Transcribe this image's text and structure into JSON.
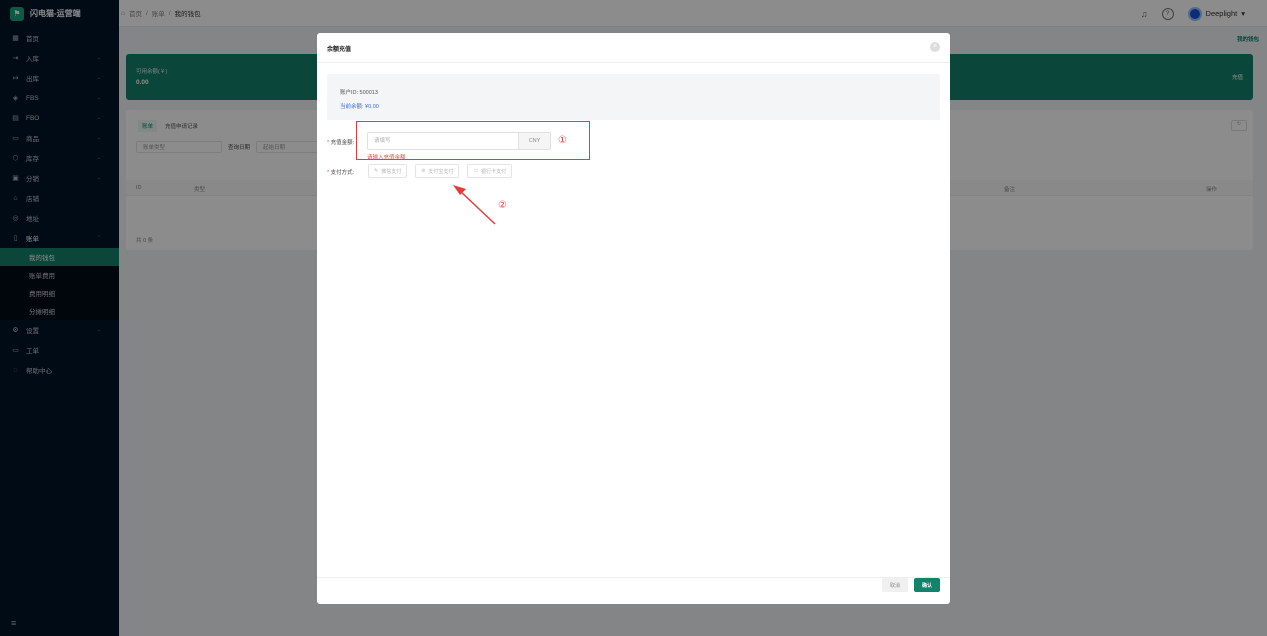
{
  "app": {
    "name": "闪电猫-运营端"
  },
  "breadcrumb": [
    "首页",
    "账单",
    "我的钱包"
  ],
  "header": {
    "username": "Deeplight"
  },
  "sidebar": {
    "items": [
      {
        "label": "首页",
        "icon": "home-icon"
      },
      {
        "label": "入库",
        "icon": "inbound-icon"
      },
      {
        "label": "出库",
        "icon": "outbound-icon"
      },
      {
        "label": "FBS",
        "icon": "cube-icon"
      },
      {
        "label": "FBO",
        "icon": "warehouse-icon"
      },
      {
        "label": "商品",
        "icon": "bag-icon"
      },
      {
        "label": "库存",
        "icon": "box-icon"
      },
      {
        "label": "分销",
        "icon": "share-icon"
      },
      {
        "label": "店铺",
        "icon": "shop-icon"
      },
      {
        "label": "地址",
        "icon": "location-icon"
      },
      {
        "label": "账单",
        "icon": "bill-icon"
      }
    ],
    "bill_sub": [
      "我的钱包",
      "账单费用",
      "费用明细",
      "分摊明细"
    ],
    "items_after": [
      {
        "label": "设置",
        "icon": "gear-icon"
      },
      {
        "label": "工单",
        "icon": "ticket-icon"
      },
      {
        "label": "帮助中心",
        "icon": "help-icon"
      }
    ]
  },
  "page": {
    "tag": "我的钱包",
    "balance_label": "可用余额(￥)",
    "balance_value": "0.00",
    "recharge": "充值",
    "tabs": [
      "账单",
      "充值申请记录"
    ],
    "filter_type_placeholder": "账单类型",
    "filter_date_label": "查询日期",
    "filter_start": "起始日期",
    "columns": [
      "ID",
      "类型",
      "备注",
      "操作"
    ],
    "total": "共 0 条"
  },
  "modal": {
    "title": "余额充值",
    "account_id": "账户ID: 500013",
    "current_balance": "当前余额: ¥0.00",
    "amount_label": "充值金额:",
    "amount_placeholder": "请填写",
    "currency": "CNY",
    "amount_error": "请输入充值金额",
    "pay_label": "支付方式:",
    "pay_methods": [
      "微信支付",
      "支付宝支付",
      "银行卡支付"
    ],
    "cancel": "取消",
    "confirm": "确认",
    "annotation_1": "①",
    "annotation_2": "②"
  },
  "colors": {
    "brand": "#13826a",
    "sidebar": "#001529",
    "annotation": "#e63b3b"
  }
}
